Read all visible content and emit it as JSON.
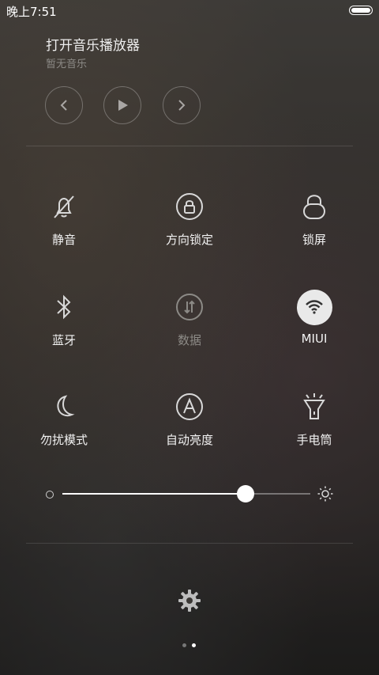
{
  "status": {
    "time": "晚上7:51"
  },
  "music": {
    "title": "打开音乐播放器",
    "subtitle": "暂无音乐",
    "controls": [
      "previous",
      "play",
      "next"
    ]
  },
  "toggles": [
    {
      "label": "静音",
      "icon": "bell-off-icon",
      "state": "off"
    },
    {
      "label": "方向锁定",
      "icon": "rotation-lock-icon",
      "state": "off"
    },
    {
      "label": "锁屏",
      "icon": "lock-icon",
      "state": "off"
    },
    {
      "label": "蓝牙",
      "icon": "bluetooth-icon",
      "state": "off"
    },
    {
      "label": "数据",
      "icon": "mobile-data-icon",
      "state": "disabled"
    },
    {
      "label": "MIUI",
      "icon": "wifi-icon",
      "state": "on"
    },
    {
      "label": "勿扰模式",
      "icon": "moon-icon",
      "state": "off"
    },
    {
      "label": "自动亮度",
      "icon": "auto-brightness-icon",
      "state": "off"
    },
    {
      "label": "手电筒",
      "icon": "flashlight-icon",
      "state": "off"
    }
  ],
  "brightness": {
    "level": 0.74
  },
  "pager": {
    "pages": 2,
    "active": 1
  }
}
